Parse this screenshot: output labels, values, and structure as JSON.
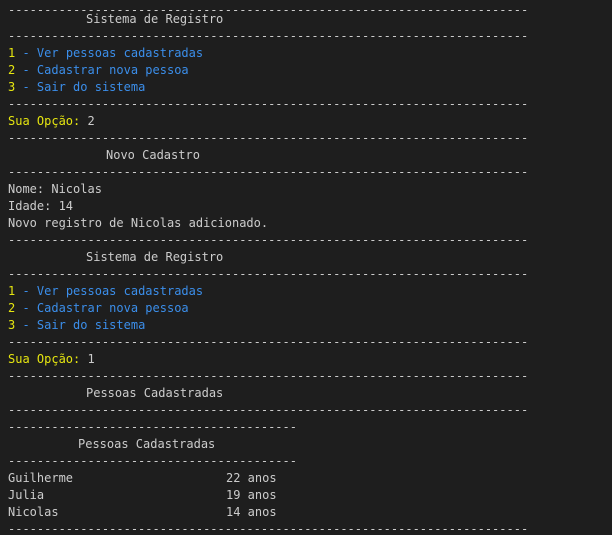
{
  "terminal": {
    "separator_long": "------------------------------------------------------------------------",
    "separator_short": "----------------------------------------",
    "colors": {
      "background": "#1e1e1e",
      "text": "#cccccc",
      "number_yellow": "#e5e510",
      "option_blue": "#3b8eea"
    },
    "menu1": {
      "title": "Sistema de Registro",
      "options": [
        {
          "number": "1",
          "sep": " - ",
          "label": "Ver pessoas cadastradas"
        },
        {
          "number": "2",
          "sep": " - ",
          "label": "Cadastrar nova pessoa"
        },
        {
          "number": "3",
          "sep": " - ",
          "label": "Sair do sistema"
        }
      ],
      "prompt_label": "Sua Opção:",
      "prompt_value": " 2"
    },
    "cadastro": {
      "title": "Novo Cadastro",
      "nome_line": "Nome: Nicolas",
      "idade_line": "Idade: 14",
      "result_line": "Novo registro de Nicolas adicionado."
    },
    "menu2": {
      "title": "Sistema de Registro",
      "options": [
        {
          "number": "1",
          "sep": " - ",
          "label": "Ver pessoas cadastradas"
        },
        {
          "number": "2",
          "sep": " - ",
          "label": "Cadastrar nova pessoa"
        },
        {
          "number": "3",
          "sep": " - ",
          "label": "Sair do sistema"
        }
      ],
      "prompt_label": "Sua Opção:",
      "prompt_value": " 1"
    },
    "listing": {
      "header_title": "Pessoas Cadastradas",
      "inner_title": "Pessoas Cadastradas",
      "people": [
        {
          "name": "Guilherme",
          "age": "22 anos"
        },
        {
          "name": "Julia",
          "age": "19 anos"
        },
        {
          "name": "Nicolas",
          "age": "14 anos"
        }
      ]
    }
  }
}
